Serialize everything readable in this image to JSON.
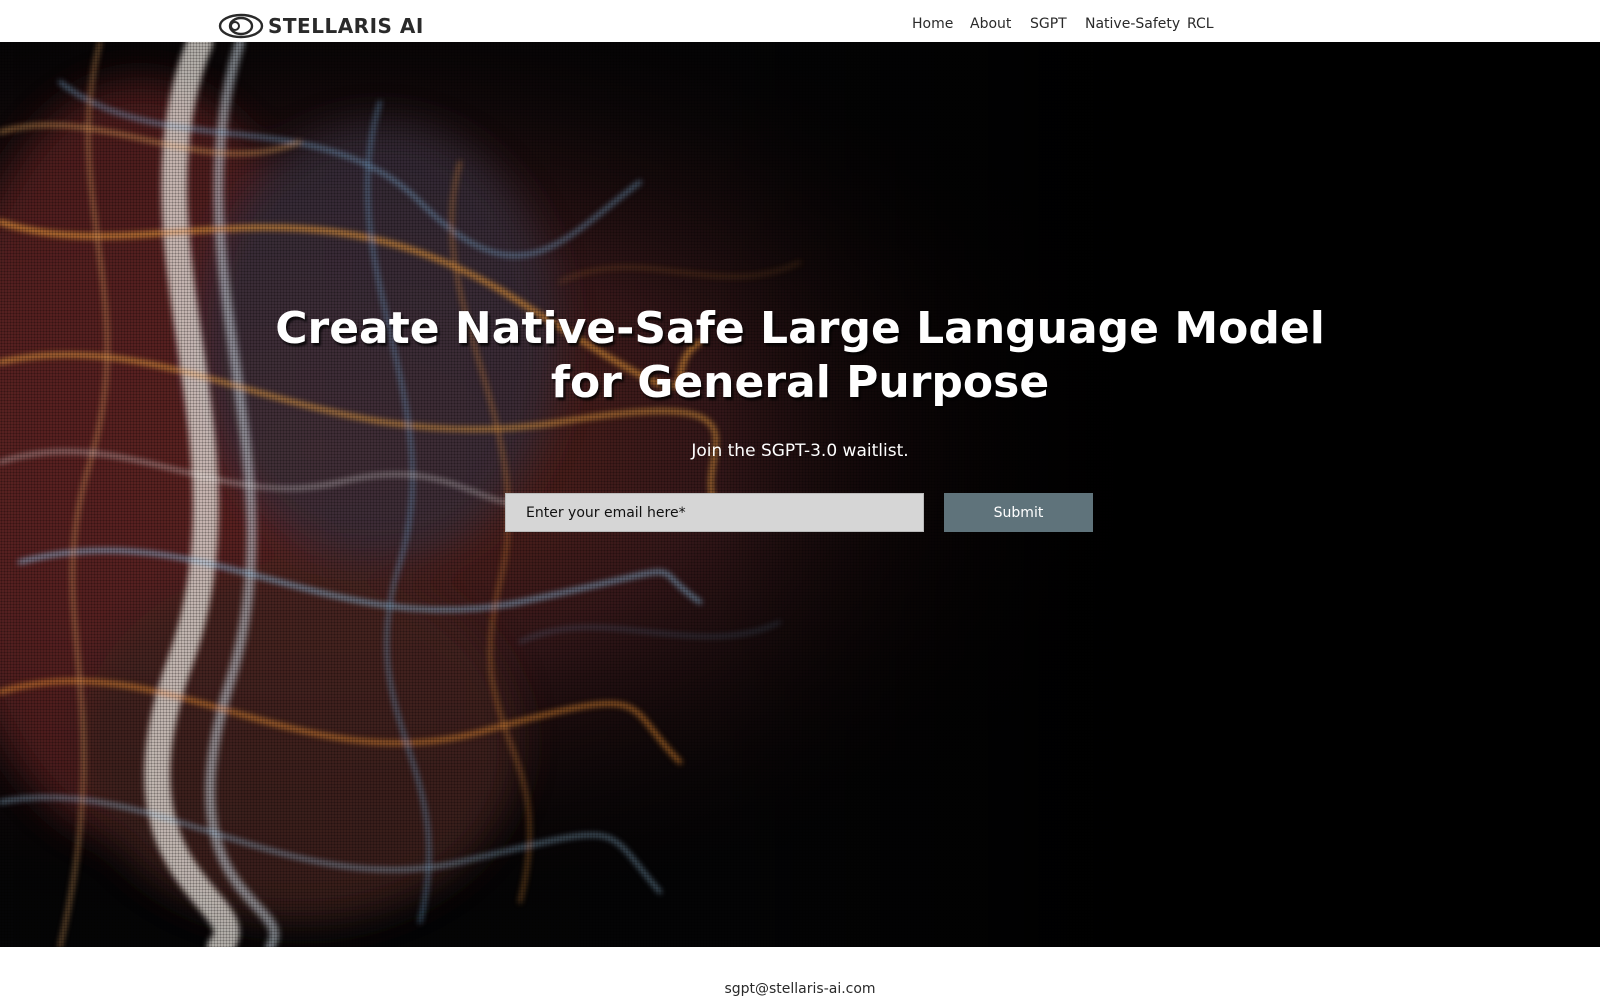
{
  "header": {
    "logo_text": "STELLARIS AI",
    "logo_icon": "eye-orbit-logo-icon",
    "nav": [
      {
        "label": "Home"
      },
      {
        "label": "About"
      },
      {
        "label": "SGPT"
      },
      {
        "label": "Native-Safety"
      },
      {
        "label": "RCL"
      }
    ]
  },
  "hero": {
    "headline_line1": "Create Native-Safe Large Language Model",
    "headline_line2": "for General Purpose",
    "subtext": "Join the SGPT-3.0 waitlist.",
    "email_placeholder": "Enter your email here*",
    "email_value": "",
    "submit_label": "Submit",
    "background": "abstract flowing smoke/light streaks in orange and blue on black"
  },
  "footer": {
    "email": "sgpt@stellaris-ai.com"
  },
  "colors": {
    "header_bg": "#ffffff",
    "hero_bg": "#000000",
    "submit_bg": "#5f737b",
    "input_bg": "#d6d6d6",
    "text_dark": "#2a2a2a"
  }
}
